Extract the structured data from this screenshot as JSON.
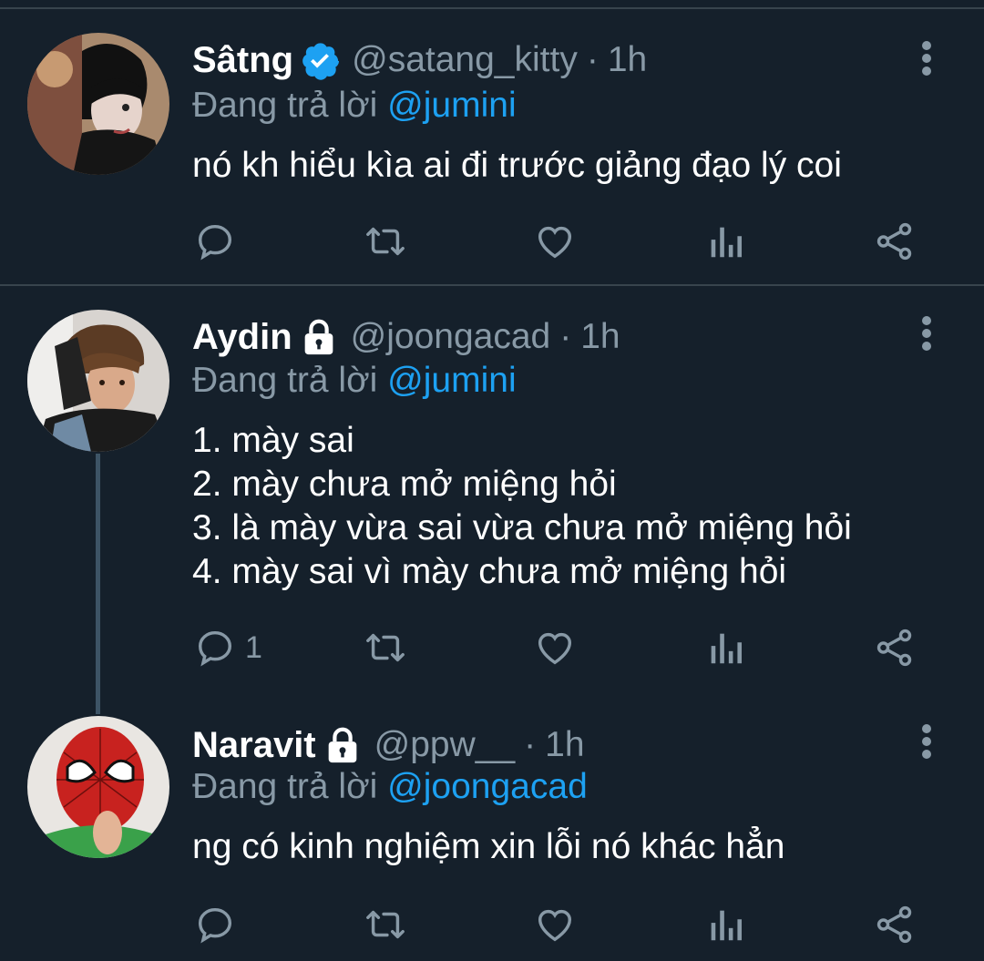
{
  "colors": {
    "background": "#15202b",
    "divider": "#38444d",
    "text_primary": "#ffffff",
    "text_secondary": "#8899a6",
    "accent": "#1da1f2"
  },
  "reply_prefix": "Đang trả lời",
  "tweets": [
    {
      "name": "Sâtng",
      "badge": "verified-icon",
      "handle": "@satang_kitty",
      "sep": "·",
      "time": "1h",
      "reply_to": "@jumini",
      "lines": [
        "nó kh hiểu kìa ai đi trước giảng đạo lý coi"
      ],
      "reply_count": ""
    },
    {
      "name": "Aydin",
      "badge": "lock-icon",
      "handle": "@joongacad",
      "sep": "·",
      "time": "1h",
      "reply_to": "@jumini",
      "lines": [
        "1. mày sai",
        "2. mày chưa mở miệng hỏi",
        "3. là mày vừa sai vừa chưa mở miệng hỏi",
        "4. mày sai vì mày chưa mở miệng hỏi"
      ],
      "reply_count": "1"
    },
    {
      "name": "Naravit",
      "badge": "lock-icon",
      "handle": "@ppw__",
      "sep": "·",
      "time": "1h",
      "reply_to": "@joongacad",
      "lines": [
        "ng có kinh nghiệm xin lỗi nó khác hẳn"
      ],
      "reply_count": ""
    }
  ]
}
